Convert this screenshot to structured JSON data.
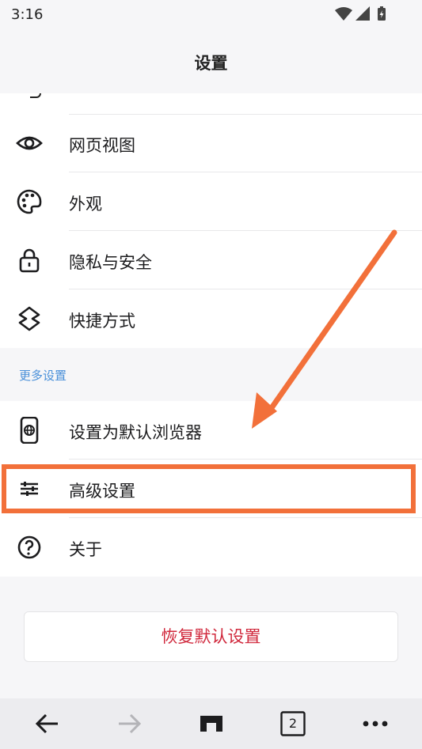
{
  "status": {
    "time": "3:16"
  },
  "header": {
    "title": "设置"
  },
  "settings_items": [
    {
      "label": "网页视图",
      "icon": "eye-icon"
    },
    {
      "label": "外观",
      "icon": "palette-icon"
    },
    {
      "label": "隐私与安全",
      "icon": "lock-icon"
    },
    {
      "label": "快捷方式",
      "icon": "shortcut-icon"
    }
  ],
  "more": {
    "header": "更多设置",
    "items": [
      {
        "label": "设置为默认浏览器",
        "icon": "phone-globe-icon"
      },
      {
        "label": "高级设置",
        "icon": "sliders-icon"
      },
      {
        "label": "关于",
        "icon": "help-icon"
      }
    ]
  },
  "reset": {
    "label": "恢复默认设置"
  },
  "bottom_nav": {
    "tab_count": "2"
  },
  "colors": {
    "accent_red": "#d0283c",
    "section_blue": "#4a90d9",
    "annotation": "#f2703a"
  }
}
